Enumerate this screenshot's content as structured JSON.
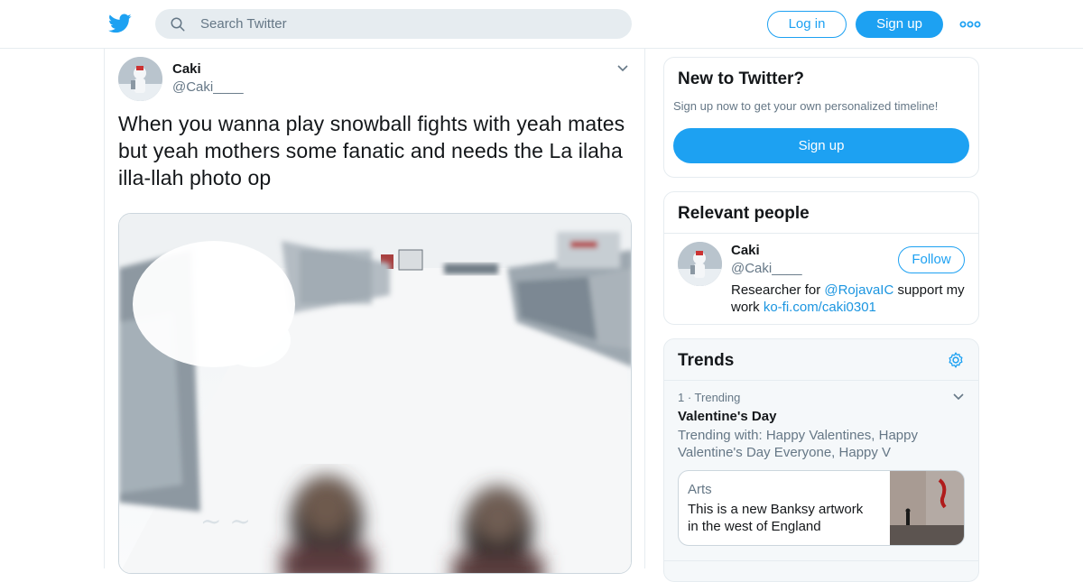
{
  "header": {
    "search_placeholder": "Search Twitter",
    "login_label": "Log in",
    "signup_label": "Sign up"
  },
  "tweet": {
    "author_name": "Caki",
    "author_handle": "@Caki____",
    "text": "When you wanna play snowball fights with yeah mates but yeah mothers some fanatic and needs the La ilaha illa-llah photo op"
  },
  "sidebar": {
    "new_to_twitter": {
      "title": "New to Twitter?",
      "subtitle": "Sign up now to get your own personalized timeline!",
      "signup_label": "Sign up"
    },
    "relevant_people": {
      "title": "Relevant people",
      "name": "Caki",
      "handle": "@Caki____",
      "follow_label": "Follow",
      "bio_prefix": "Researcher for ",
      "bio_mention": "@RojavaIC",
      "bio_middle": " support my work ",
      "bio_link": "ko-fi.com/caki0301"
    },
    "trends": {
      "title": "Trends",
      "items": [
        {
          "meta": "1 · Trending",
          "name": "Valentine's Day",
          "trending_with": "Trending with: Happy Valentines, Happy Valentine's Day Everyone, Happy V",
          "card_category": "Arts",
          "card_headline": "This is a new Banksy artwork in the west of England"
        }
      ]
    }
  },
  "colors": {
    "accent": "#1da1f2",
    "link": "#1b95e0",
    "secondary_text": "#657786",
    "border": "#e6ecf0"
  },
  "icons": [
    "twitter-bird-icon",
    "search-icon",
    "more-dots-icon",
    "chevron-down-icon",
    "gear-icon"
  ]
}
